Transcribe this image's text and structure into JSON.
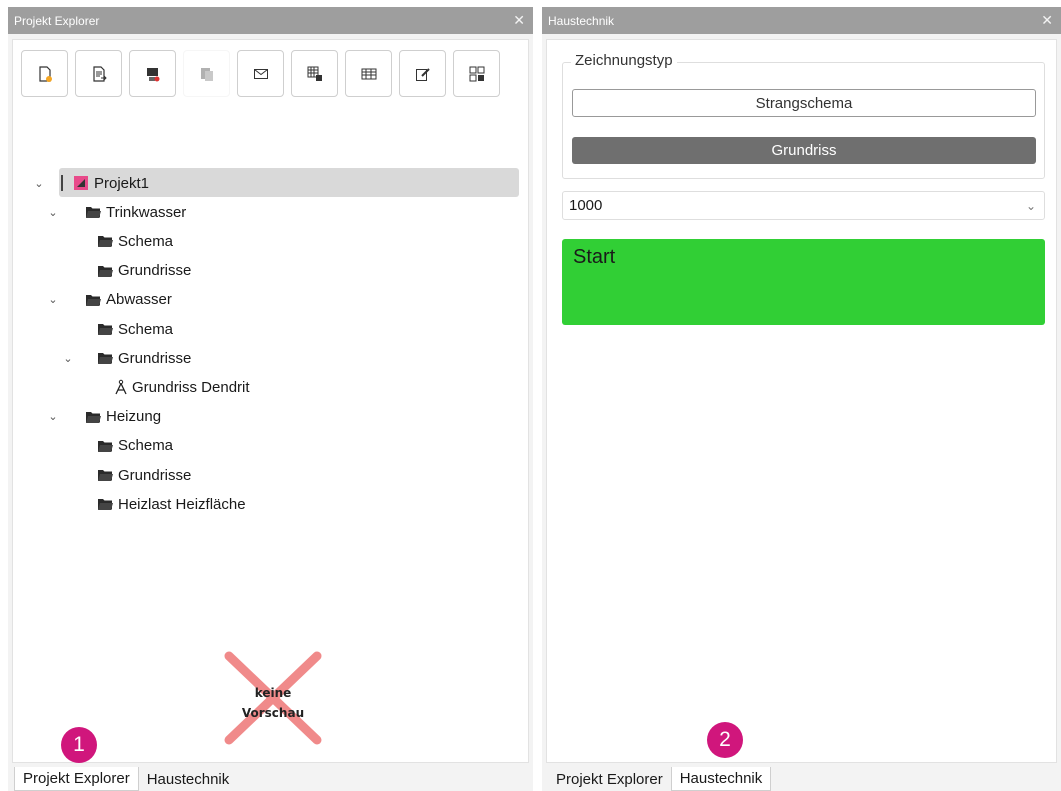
{
  "left": {
    "title": "Projekt Explorer",
    "close": "✕",
    "toolbar": [
      "new-file-icon",
      "import-file-icon",
      "export-icon",
      "copy-icon",
      "mail-icon",
      "grid-export-icon",
      "table-icon",
      "edit-icon",
      "layout-icon"
    ],
    "tree": {
      "root": "Projekt1",
      "items": [
        {
          "label": "Trinkwasser",
          "level": 1,
          "expanded": true
        },
        {
          "label": "Schema",
          "level": 2
        },
        {
          "label": "Grundrisse",
          "level": 2
        },
        {
          "label": "Abwasser",
          "level": 1,
          "expanded": true
        },
        {
          "label": "Schema",
          "level": 2
        },
        {
          "label": "Grundrisse",
          "level": 2,
          "expanded": true
        },
        {
          "label": "Grundriss Dendrit",
          "level": 3,
          "compass": true
        },
        {
          "label": "Heizung",
          "level": 1,
          "expanded": true
        },
        {
          "label": "Schema",
          "level": 2
        },
        {
          "label": "Grundrisse",
          "level": 2
        },
        {
          "label": "Heizlast Heizfläche",
          "level": 2
        }
      ]
    },
    "preview": {
      "line1": "keine",
      "line2": "Vorschau"
    },
    "tabs": [
      "Projekt Explorer",
      "Haustechnik"
    ],
    "badge": "1"
  },
  "right": {
    "title": "Haustechnik",
    "close": "✕",
    "group_label": "Zeichnungstyp",
    "button_strang": "Strangschema",
    "button_grund": "Grundriss",
    "select_value": "1000",
    "start_label": "Start",
    "tabs": [
      "Projekt Explorer",
      "Haustechnik"
    ],
    "badge": "2"
  },
  "colors": {
    "accent_badge": "#d0167c",
    "start_green": "#31cf35",
    "title_bar": "#9e9e9e"
  }
}
